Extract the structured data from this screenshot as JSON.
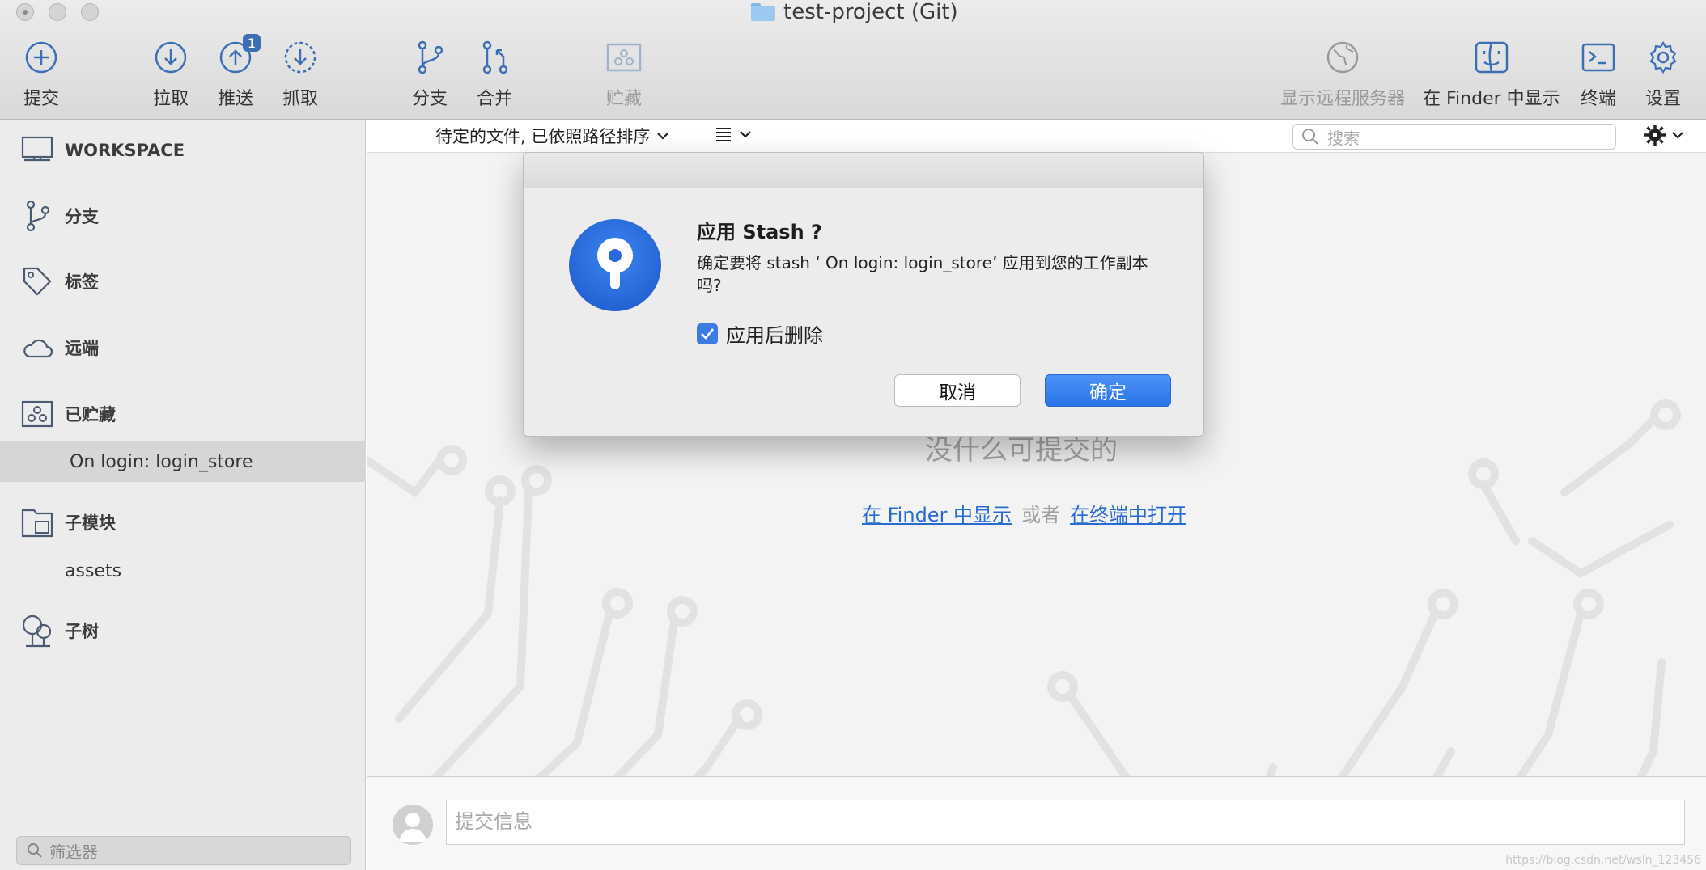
{
  "window": {
    "title": "test-project (Git)"
  },
  "toolbar": {
    "commit": "提交",
    "pull": "拉取",
    "push": "推送",
    "push_badge": "1",
    "fetch": "抓取",
    "branch": "分支",
    "merge": "合并",
    "stash": "贮藏",
    "show_remote": "显示远程服务器",
    "show_in_finder": "在 Finder 中显示",
    "terminal": "终端",
    "settings": "设置"
  },
  "sidebar": {
    "workspace": "WORKSPACE",
    "branches": "分支",
    "tags": "标签",
    "remotes": "远端",
    "stashes": "已贮藏",
    "stash_item": "On login: login_store",
    "submodules": "子模块",
    "submodule_item": "assets",
    "subtrees": "子树",
    "filter_placeholder": "筛选器"
  },
  "main": {
    "sort_label": "待定的文件, 已依照路径排序",
    "search_placeholder": "搜索",
    "empty_title": "没什么可提交的",
    "link_finder": "在 Finder 中显示",
    "or_text": "或者",
    "link_terminal": "在终端中打开",
    "commit_placeholder": "提交信息"
  },
  "dialog": {
    "title": "应用 Stash ?",
    "message": "确定要将 stash ‘ On login: login_store’ 应用到您的工作副本吗?",
    "checkbox_label": "应用后删除",
    "checkbox_checked": true,
    "cancel": "取消",
    "confirm": "确定"
  },
  "watermark": "https://blog.csdn.net/wsln_123456",
  "colors": {
    "accent": "#2a74e8",
    "link": "#2a6bd1",
    "icon": "#3c6fb6"
  }
}
